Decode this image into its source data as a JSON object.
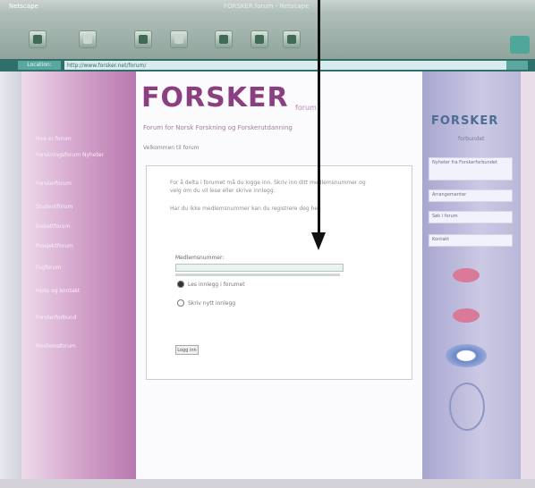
{
  "window": {
    "app_title": "Netscape",
    "window_title": "FORSKER.forum - Netscape"
  },
  "toolbar": {
    "buttons": [
      {
        "name": "back-button",
        "icon": "arrow-left-icon"
      },
      {
        "name": "forward-button",
        "icon": "arrow-right-icon"
      },
      {
        "name": "reload-button",
        "icon": "reload-icon"
      },
      {
        "name": "home-button",
        "icon": "home-icon"
      },
      {
        "name": "search-button",
        "icon": "search-icon"
      },
      {
        "name": "print-button",
        "icon": "print-icon"
      },
      {
        "name": "security-button",
        "icon": "lock-icon"
      }
    ]
  },
  "address_bar": {
    "label": "Location:",
    "value": "http://www.forsker.net/forum/"
  },
  "left_nav": {
    "items": [
      "Hva er forum",
      "Forskningsforum Nyheter",
      "Forskerforum",
      "Studentforum",
      "Debattforum",
      "Prosjektforum",
      "Fagforum",
      "Hjelp og kontakt",
      "Forskerforbund",
      "Medlemsforum"
    ]
  },
  "main": {
    "logo": "FORSKER",
    "logo_sub": "forum",
    "tagline": "Forum for Norsk Forskning og Forskerutdanning",
    "breadcrumb": "Velkommen til forum",
    "intro1": "For å delta i forumet må du logge inn. Skriv inn ditt medlemsnummer og velg om du vil lese eller skrive innlegg.",
    "intro2": "Har du ikke medlemsnummer kan du registrere deg her.",
    "field_label": "Medlemsnummer:",
    "field_value": "",
    "radio1": "Les innlegg i forumet",
    "radio2": "Skriv nytt innlegg",
    "submit": "Logg inn"
  },
  "right_col": {
    "logo": "FORSKER",
    "logo_sub": "forbundet",
    "boxes": [
      "Nyheter fra Forskerforbundet",
      "Arrangementer",
      "Søk i forum",
      "Kontakt"
    ]
  }
}
